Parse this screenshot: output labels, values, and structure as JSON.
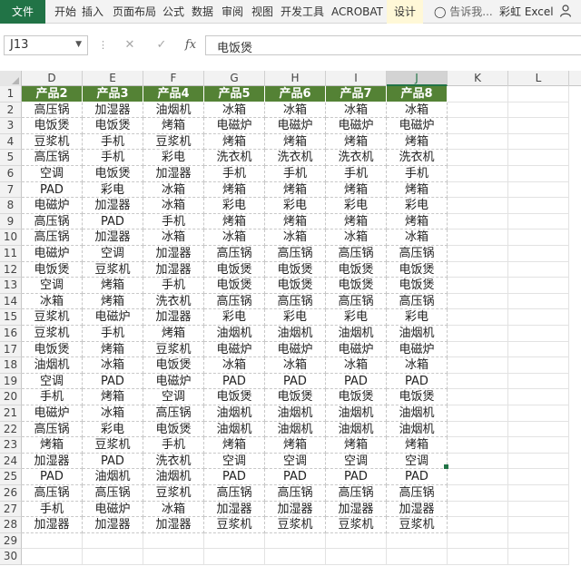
{
  "ribbon": {
    "tabs": [
      "文件",
      "开始",
      "插入",
      "页面布局",
      "公式",
      "数据",
      "审阅",
      "视图",
      "开发工具",
      "ACROBAT",
      "设计"
    ],
    "tell_me": "告诉我...",
    "user": "彩虹 Excel"
  },
  "formula_bar": {
    "name_box": "J13",
    "cancel_icon": "✕",
    "enter_icon": "✓",
    "fx_label": "fx",
    "content": "电饭煲"
  },
  "columns": [
    "D",
    "E",
    "F",
    "G",
    "H",
    "I",
    "J",
    "K",
    "L"
  ],
  "selected_column": "J",
  "header_row": [
    "产品2",
    "产品3",
    "产品4",
    "产品5",
    "产品6",
    "产品7",
    "产品8"
  ],
  "rows": [
    [
      "高压锅",
      "加湿器",
      "油烟机",
      "冰箱",
      "冰箱",
      "冰箱",
      "冰箱"
    ],
    [
      "电饭煲",
      "电饭煲",
      "烤箱",
      "电磁炉",
      "电磁炉",
      "电磁炉",
      "电磁炉"
    ],
    [
      "豆浆机",
      "手机",
      "豆浆机",
      "烤箱",
      "烤箱",
      "烤箱",
      "烤箱"
    ],
    [
      "高压锅",
      "手机",
      "彩电",
      "洗衣机",
      "洗衣机",
      "洗衣机",
      "洗衣机"
    ],
    [
      "空调",
      "电饭煲",
      "加湿器",
      "手机",
      "手机",
      "手机",
      "手机"
    ],
    [
      "PAD",
      "彩电",
      "冰箱",
      "烤箱",
      "烤箱",
      "烤箱",
      "烤箱"
    ],
    [
      "电磁炉",
      "加湿器",
      "冰箱",
      "彩电",
      "彩电",
      "彩电",
      "彩电"
    ],
    [
      "高压锅",
      "PAD",
      "手机",
      "烤箱",
      "烤箱",
      "烤箱",
      "烤箱"
    ],
    [
      "高压锅",
      "加湿器",
      "冰箱",
      "冰箱",
      "冰箱",
      "冰箱",
      "冰箱"
    ],
    [
      "电磁炉",
      "空调",
      "加湿器",
      "高压锅",
      "高压锅",
      "高压锅",
      "高压锅"
    ],
    [
      "电饭煲",
      "豆浆机",
      "加湿器",
      "电饭煲",
      "电饭煲",
      "电饭煲",
      "电饭煲"
    ],
    [
      "空调",
      "烤箱",
      "手机",
      "电饭煲",
      "电饭煲",
      "电饭煲",
      "电饭煲"
    ],
    [
      "冰箱",
      "烤箱",
      "洗衣机",
      "高压锅",
      "高压锅",
      "高压锅",
      "高压锅"
    ],
    [
      "豆浆机",
      "电磁炉",
      "加湿器",
      "彩电",
      "彩电",
      "彩电",
      "彩电"
    ],
    [
      "豆浆机",
      "手机",
      "烤箱",
      "油烟机",
      "油烟机",
      "油烟机",
      "油烟机"
    ],
    [
      "电饭煲",
      "烤箱",
      "豆浆机",
      "电磁炉",
      "电磁炉",
      "电磁炉",
      "电磁炉"
    ],
    [
      "油烟机",
      "冰箱",
      "电饭煲",
      "冰箱",
      "冰箱",
      "冰箱",
      "冰箱"
    ],
    [
      "空调",
      "PAD",
      "电磁炉",
      "PAD",
      "PAD",
      "PAD",
      "PAD"
    ],
    [
      "手机",
      "烤箱",
      "空调",
      "电饭煲",
      "电饭煲",
      "电饭煲",
      "电饭煲"
    ],
    [
      "电磁炉",
      "冰箱",
      "高压锅",
      "油烟机",
      "油烟机",
      "油烟机",
      "油烟机"
    ],
    [
      "高压锅",
      "彩电",
      "电饭煲",
      "油烟机",
      "油烟机",
      "油烟机",
      "油烟机"
    ],
    [
      "烤箱",
      "豆浆机",
      "手机",
      "烤箱",
      "烤箱",
      "烤箱",
      "烤箱"
    ],
    [
      "加湿器",
      "PAD",
      "洗衣机",
      "空调",
      "空调",
      "空调",
      "空调"
    ],
    [
      "PAD",
      "油烟机",
      "油烟机",
      "PAD",
      "PAD",
      "PAD",
      "PAD"
    ],
    [
      "高压锅",
      "高压锅",
      "豆浆机",
      "高压锅",
      "高压锅",
      "高压锅",
      "高压锅"
    ],
    [
      "手机",
      "电磁炉",
      "冰箱",
      "加湿器",
      "加湿器",
      "加湿器",
      "加湿器"
    ],
    [
      "加湿器",
      "加湿器",
      "加湿器",
      "豆浆机",
      "豆浆机",
      "豆浆机",
      "豆浆机"
    ]
  ],
  "row_numbers": [
    "1",
    "2",
    "3",
    "4",
    "5",
    "6",
    "7",
    "8",
    "9",
    "10",
    "11",
    "12",
    "13",
    "14",
    "15",
    "16",
    "17",
    "18",
    "19",
    "20",
    "21",
    "22",
    "23",
    "24",
    "25",
    "26",
    "27",
    "28",
    "29",
    "30"
  ],
  "colors": {
    "accent": "#217346",
    "header_fill": "#548235",
    "design_tab": "#fff8d7"
  }
}
